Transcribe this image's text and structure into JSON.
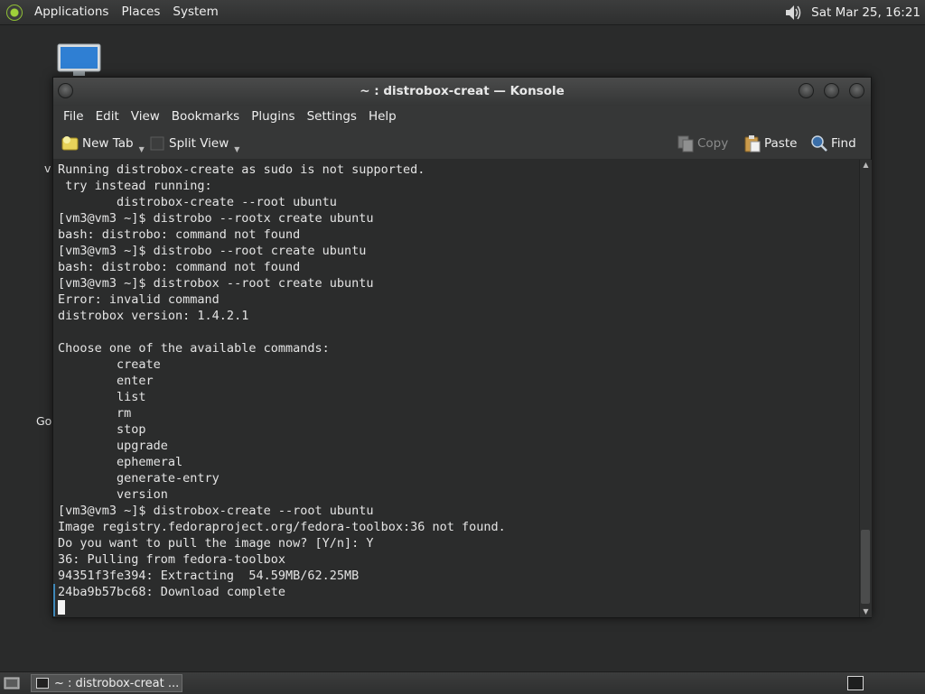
{
  "top_panel": {
    "menus": [
      "Applications",
      "Places",
      "System"
    ],
    "clock": "Sat Mar 25, 16:21",
    "icons": [
      "distro-logo-icon",
      "volume-icon"
    ]
  },
  "desktop": {
    "icons": [
      {
        "name": "computer-icon",
        "label": ""
      },
      {
        "label": "v"
      },
      {
        "label": "Go"
      }
    ]
  },
  "window": {
    "title": "~ : distrobox-creat — Konsole",
    "menus": [
      "File",
      "Edit",
      "View",
      "Bookmarks",
      "Plugins",
      "Settings",
      "Help"
    ],
    "toolbar": {
      "new_tab": "New Tab",
      "split_view": "Split View",
      "copy": "Copy",
      "paste": "Paste",
      "find": "Find"
    },
    "terminal_lines": [
      "Running distrobox-create as sudo is not supported.",
      " try instead running:",
      "        distrobox-create --root ubuntu",
      "[vm3@vm3 ~]$ distrobo --rootx create ubuntu",
      "bash: distrobo: command not found",
      "[vm3@vm3 ~]$ distrobo --root create ubuntu",
      "bash: distrobo: command not found",
      "[vm3@vm3 ~]$ distrobox --root create ubuntu",
      "Error: invalid command",
      "distrobox version: 1.4.2.1",
      "",
      "Choose one of the available commands:",
      "        create",
      "        enter",
      "        list",
      "        rm",
      "        stop",
      "        upgrade",
      "        ephemeral",
      "        generate-entry",
      "        version",
      "[vm3@vm3 ~]$ distrobox-create --root ubuntu",
      "Image registry.fedoraproject.org/fedora-toolbox:36 not found.",
      "Do you want to pull the image now? [Y/n]: Y",
      "36: Pulling from fedora-toolbox",
      "94351f3fe394: Extracting  54.59MB/62.25MB",
      "24ba9b57bc68: Download complete"
    ]
  },
  "bottom_panel": {
    "task_label": "~ : distrobox-creat ..."
  },
  "colors": {
    "panel": "#2e2f2f",
    "terminal_bg": "#2b2c2c",
    "terminal_fg": "#e4e4e4",
    "accent": "#3f88b8"
  }
}
